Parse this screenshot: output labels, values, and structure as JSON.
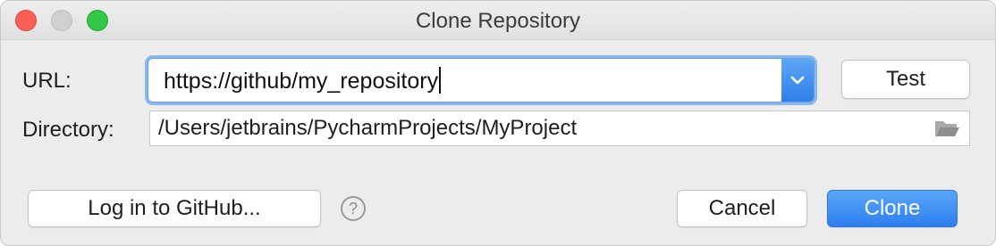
{
  "window": {
    "title": "Clone Repository"
  },
  "form": {
    "url_label": "URL:",
    "url_value": "https://github/my_repository",
    "directory_label": "Directory:",
    "directory_value": "/Users/jetbrains/PycharmProjects/MyProject"
  },
  "buttons": {
    "test": "Test",
    "login": "Log in to GitHub...",
    "help": "?",
    "cancel": "Cancel",
    "clone": "Clone"
  },
  "icons": {
    "dropdown": "chevron-down-icon",
    "folder": "folder-open-icon",
    "help": "help-icon"
  },
  "colors": {
    "accent": "#2d7ff0",
    "close": "#fc5f57",
    "maximize": "#33c748"
  }
}
